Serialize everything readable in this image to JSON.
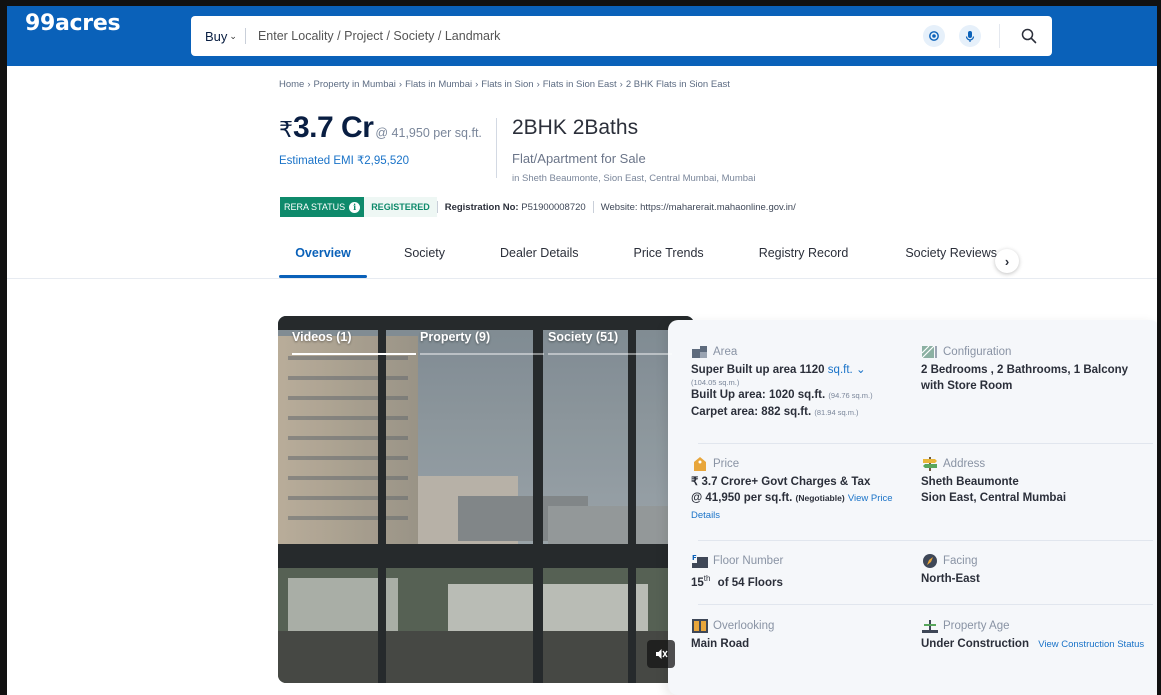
{
  "header": {
    "logo": "99acres",
    "buy_label": "Buy",
    "search_placeholder": "Enter Locality / Project / Society / Landmark",
    "brand_color": "#0a61b9"
  },
  "breadcrumb": [
    "Home",
    "Property in Mumbai",
    "Flats in Mumbai",
    "Flats in Sion",
    "Flats in Sion East",
    "2 BHK Flats in Sion East"
  ],
  "listing": {
    "rupee": "₹",
    "price": "3.7 Cr",
    "per_sqft": "@ 41,950 per sq.ft.",
    "emi": "Estimated EMI ₹2,95,520",
    "title": "2BHK 2Baths",
    "subtitle": "Flat/Apartment for Sale",
    "address_line": "in Sheth Beaumonte, Sion East, Central Mumbai, Mumbai"
  },
  "rera": {
    "status_label": "RERA STATUS",
    "registered": "REGISTERED",
    "reg_label": "Registration No:",
    "reg_no": "P51900008720",
    "website": "Website: https://maharerait.mahaonline.gov.in/"
  },
  "tabs": [
    {
      "label": "Overview",
      "active": true
    },
    {
      "label": "Society"
    },
    {
      "label": "Dealer Details"
    },
    {
      "label": "Price Trends"
    },
    {
      "label": "Registry Record"
    },
    {
      "label": "Society Reviews"
    }
  ],
  "media": {
    "tabs": [
      "Videos (1)",
      "Property (9)",
      "Society (51)"
    ]
  },
  "details": {
    "area": {
      "label": "Area",
      "super_text": "Super Built up area 1120",
      "unit": "sq.ft.",
      "super_sqm": "(104.05 sq.m.)",
      "builtup_text": "Built Up area: 1020 sq.ft.",
      "builtup_sqm": "(94.76 sq.m.)",
      "carpet_text": "Carpet area: 882 sq.ft.",
      "carpet_sqm": "(81.94 sq.m.)"
    },
    "configuration": {
      "label": "Configuration",
      "value": "2 Bedrooms , 2 Bathrooms, 1 Balcony with Store Room"
    },
    "price": {
      "label": "Price",
      "line1": "₹ 3.7 Crore+ Govt Charges & Tax",
      "line2": "@ 41,950 per sq.ft.",
      "negotiable": "(Negotiable)",
      "link": "View Price Details"
    },
    "address": {
      "label": "Address",
      "line1": "Sheth Beaumonte",
      "line2": "Sion East, Central Mumbai"
    },
    "floor": {
      "label": "Floor Number",
      "floor": "15",
      "sup": "th",
      "of": "of 54 Floors"
    },
    "facing": {
      "label": "Facing",
      "value": "North-East"
    },
    "overlooking": {
      "label": "Overlooking",
      "value": "Main Road"
    },
    "age": {
      "label": "Property Age",
      "value": "Under Construction",
      "link": "View Construction Status"
    }
  }
}
